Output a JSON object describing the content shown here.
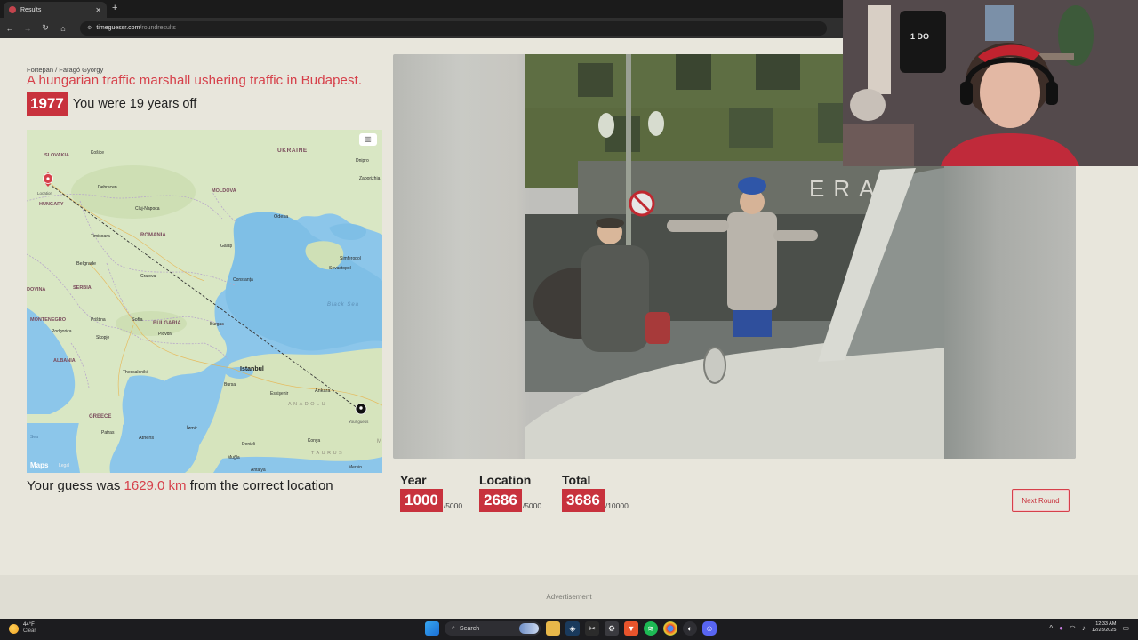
{
  "browser": {
    "tab_title": "Results",
    "new_tab": "+",
    "url_host": "timeguessr.com",
    "url_path": "/roundresults"
  },
  "result": {
    "credit": "Fortepan / Faragó György",
    "caption": "A hungarian traffic marshall ushering traffic in Budapest.",
    "year": "1977",
    "years_off": "You were 19 years off",
    "distance_prefix": "Your guess was ",
    "distance": "1629.0 km",
    "distance_suffix": " from the correct location"
  },
  "map": {
    "labels": {
      "ukraine": "UKRAINE",
      "slovakia": "SLOVAKIA",
      "kosice": "Košice",
      "dnipro": "Dnipro",
      "zaporizhia": "Zaporizhia",
      "moldova": "MOLDOVA",
      "debrecen": "Debrecen",
      "location": "Location",
      "hungary": "HUNGARY",
      "cluj": "Cluj-Napoca",
      "odesa": "Odesa",
      "romania": "ROMANIA",
      "timisoara": "Timișoara",
      "galati": "Galați",
      "simferopol": "Simferopol",
      "sevastopol": "Sevastopol",
      "belgrade": "Belgrade",
      "craiova": "Craiova",
      "constanta": "Constanța",
      "serbia": "SERBIA",
      "dovina": "DOVINA",
      "black_sea": "Black Sea",
      "montenegro": "MONTENEGRO",
      "pristina": "Priština",
      "sofia": "Sofia",
      "bulgaria": "BULGARIA",
      "burgas": "Burgas",
      "podgorica": "Podgorica",
      "skopje": "Skopje",
      "plovdiv": "Plovdiv",
      "albania": "ALBANIA",
      "istanbul": "Istanbul",
      "thessaloniki": "Thessaloniki",
      "bursa": "Bursa",
      "eskisehir": "Eskişehir",
      "ankara": "Ankara",
      "anadolu": "ANADOLU",
      "greece": "GREECE",
      "izmir": "İzmir",
      "patras": "Patras",
      "athens": "Athens",
      "denizli": "Denizli",
      "konya": "Konya",
      "taurus": "TAURUS",
      "mugla": "Muğla",
      "antalya": "Antalya",
      "mersin": "Mersin",
      "your_guess": "Your guess",
      "sea": "Sea",
      "m": "M"
    },
    "logo": " Maps",
    "legal": "Legal",
    "layers_icon": "map-layers"
  },
  "scores": {
    "year_label": "Year",
    "year_value": "1000",
    "year_max": "/5000",
    "location_label": "Location",
    "location_value": "2686",
    "location_max": "/5000",
    "total_label": "Total",
    "total_value": "3686",
    "total_max": "/10000"
  },
  "buttons": {
    "next_round": "Next Round"
  },
  "ad": {
    "label": "Advertisement"
  },
  "taskbar": {
    "temp": "44°F",
    "condition": "Clear",
    "search": "Search",
    "time": "12:33 AM",
    "date": "12/28/2025"
  },
  "colors": {
    "accent": "#c8323d",
    "page_bg": "#e8e6dc"
  }
}
